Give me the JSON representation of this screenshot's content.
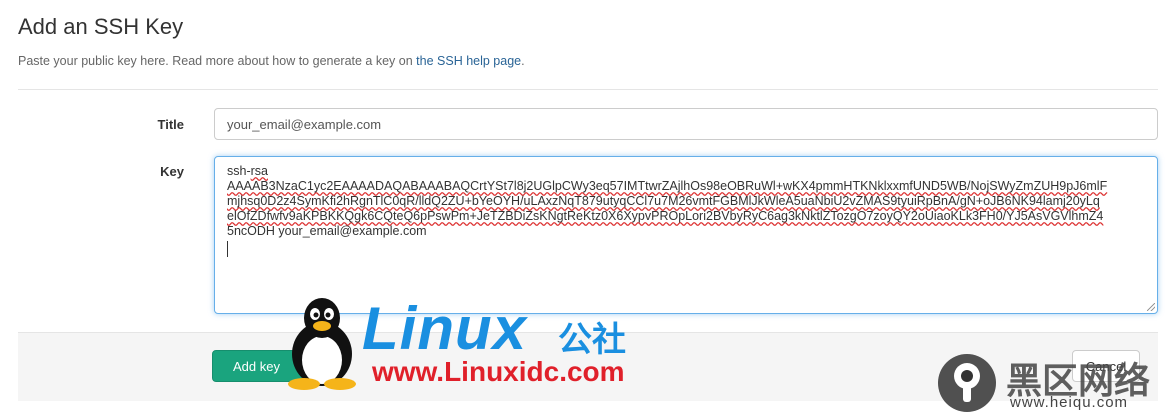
{
  "page": {
    "title": "Add an SSH Key",
    "intro_text": "Paste your public key here. Read more about how to generate a key on ",
    "help_link": "the SSH help page",
    "intro_suffix": "."
  },
  "form": {
    "title_label": "Title",
    "title_value": "your_email@example.com",
    "key_label": "Key",
    "key_lines": [
      "ssh-rsa",
      "AAAAB3NzaC1yc2EAAAADAQABAAABAQCrtYSt7l8j2UGlpCWy3eq57IMTtwrZAjlhOs98eOBRuWl+wKX4pmmHTKNklxxmfUND5WB/NojSWyZmZUH9pJ6mlF",
      "mjhsq0D2z4SymKfi2hRgnTlC0qR/lldQ2ZU+bYeOYH/uLAxzNqT879utyqCCl7u7M26vmtFGBMlJkWleA5uaNbiU2vZMAS9tyuiRpBnA/gN+oJB6NK94lamj20yLq",
      "elOfZDfwfv9aKPBKKQgk6CQteQ6pPswPm+JeTZBDiZsKNgtReKtz0X6XypvPROpLori2BVbyRyC6ag3kNktlZTozgO7zoyQY2oUiaoKLk3FH0/YJ5AsVGVlhmZ4",
      "5ncODH your_email@example.com"
    ]
  },
  "actions": {
    "submit_label": "Add key",
    "cancel_label": "Cancel"
  },
  "watermarks": {
    "linux_brand": "Linux",
    "linux_cn": "公社",
    "linux_url": "www.Linuxidc.com",
    "heiqu_cn": "黑区网络",
    "heiqu_url": "www.heiqu.com"
  },
  "colors": {
    "accent_button": "#1aa47e",
    "focus_border": "#66afe9",
    "link": "#2a6496",
    "linux_blue": "#1a8fe0",
    "linux_red": "#e0202a"
  }
}
